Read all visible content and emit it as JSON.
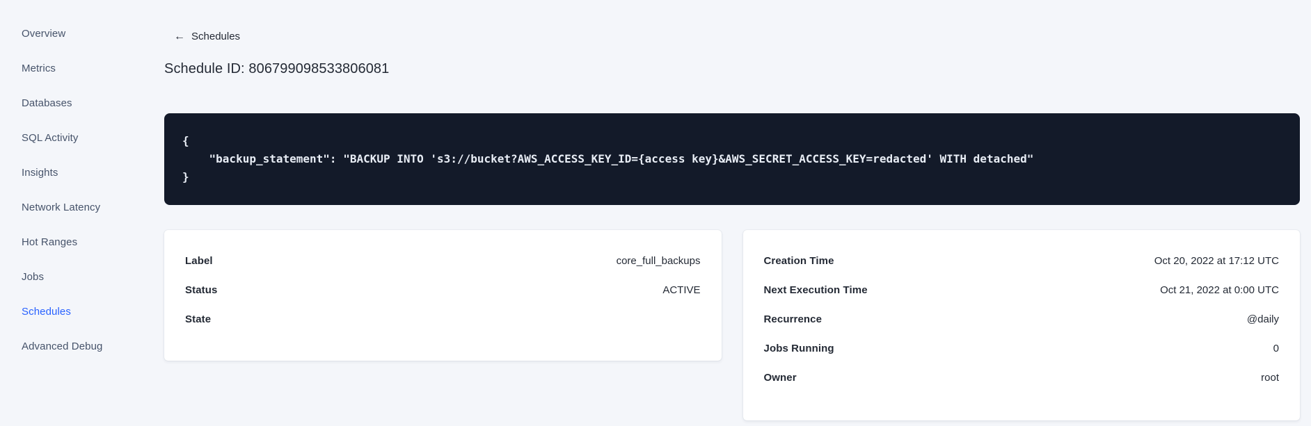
{
  "colors": {
    "page_background": "#f4f6fa",
    "active_nav_link": "#2962ff",
    "code_block_background": "#131a29",
    "code_block_text": "#e8edf5",
    "text_primary": "#242a35"
  },
  "sidebar": {
    "items": [
      {
        "label": "Overview",
        "active": false
      },
      {
        "label": "Metrics",
        "active": false
      },
      {
        "label": "Databases",
        "active": false
      },
      {
        "label": "SQL Activity",
        "active": false
      },
      {
        "label": "Insights",
        "active": false
      },
      {
        "label": "Network Latency",
        "active": false
      },
      {
        "label": "Hot Ranges",
        "active": false
      },
      {
        "label": "Jobs",
        "active": false
      },
      {
        "label": "Schedules",
        "active": true
      },
      {
        "label": "Advanced Debug",
        "active": false
      }
    ]
  },
  "header": {
    "back_icon": "←",
    "back_label": "Schedules",
    "title": "Schedule ID: 806799098533806081"
  },
  "code_block": {
    "lines": [
      "{",
      "    \"backup_statement\": \"BACKUP INTO 's3://bucket?AWS_ACCESS_KEY_ID={access key}&AWS_SECRET_ACCESS_KEY=redacted' WITH detached\"",
      "}"
    ]
  },
  "details_card": {
    "rows": [
      {
        "label": "Label",
        "value": "core_full_backups"
      },
      {
        "label": "Status",
        "value": "ACTIVE"
      },
      {
        "label": "State",
        "value": ""
      }
    ]
  },
  "schedule_card": {
    "rows": [
      {
        "label": "Creation Time",
        "value": "Oct 20, 2022 at 17:12 UTC"
      },
      {
        "label": "Next Execution Time",
        "value": "Oct 21, 2022 at 0:00 UTC"
      },
      {
        "label": "Recurrence",
        "value": "@daily"
      },
      {
        "label": "Jobs Running",
        "value": "0"
      },
      {
        "label": "Owner",
        "value": "root"
      }
    ]
  }
}
